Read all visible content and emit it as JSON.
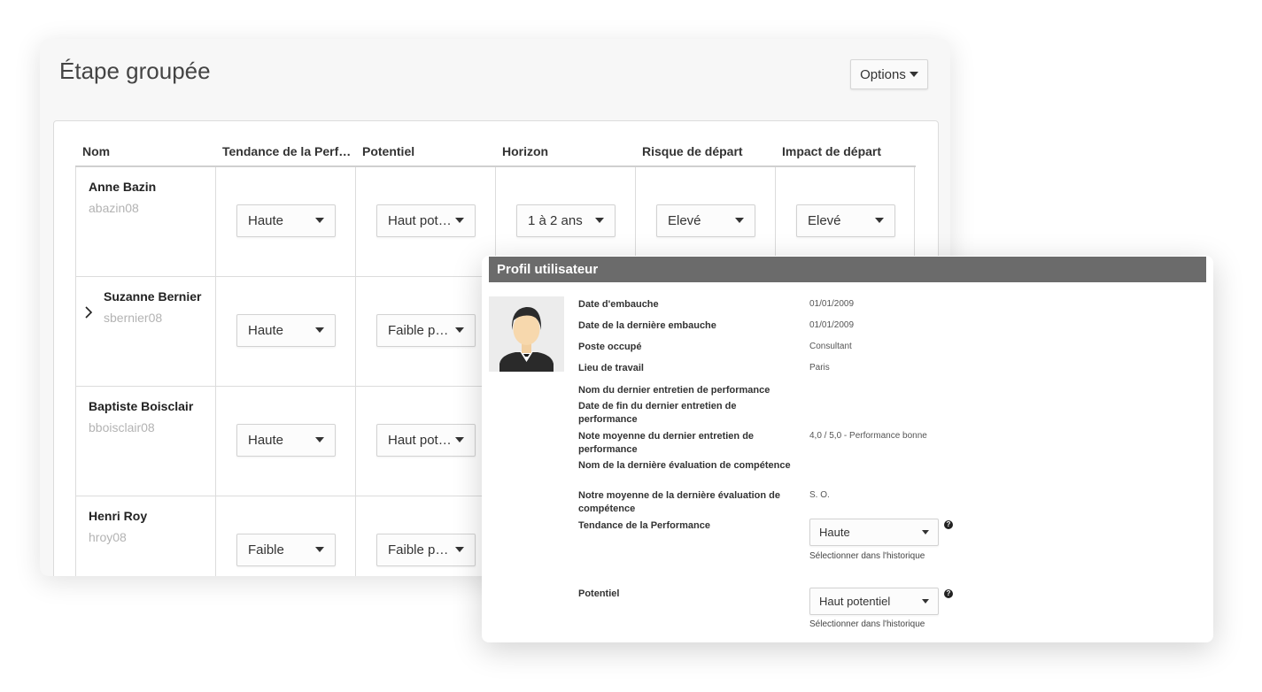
{
  "main": {
    "title": "Étape groupée",
    "options_label": "Options",
    "columns": [
      "Nom",
      "Tendance de la Performance",
      "Potentiel",
      "Horizon",
      "Risque de départ",
      "Impact de départ"
    ],
    "rows": [
      {
        "name": "Anne Bazin",
        "username": "abazin08",
        "performance": "Haute",
        "potentiel": "Haut potentiel",
        "horizon": "1 à 2 ans",
        "risque": "Elevé",
        "impact": "Elevé"
      },
      {
        "name": "Suzanne Bernier",
        "username": "sbernier08",
        "performance": "Haute",
        "potentiel": "Faible potentiel"
      },
      {
        "name": "Baptiste Boisclair",
        "username": "bboisclair08",
        "performance": "Haute",
        "potentiel": "Haut potentiel"
      },
      {
        "name": "Henri Roy",
        "username": "hroy08",
        "performance": "Faible",
        "potentiel": "Faible potentiel"
      }
    ]
  },
  "profile": {
    "title": "Profil utilisateur",
    "fields": [
      {
        "label": "Date d'embauche",
        "value": "01/01/2009"
      },
      {
        "label": "Date de la dernière embauche",
        "value": "01/01/2009"
      },
      {
        "label": "Poste occupé",
        "value": "Consultant"
      },
      {
        "label": "Lieu de travail",
        "value": "Paris"
      },
      {
        "label": "Nom du dernier entretien de performance",
        "value": ""
      },
      {
        "label": "Date de fin du dernier entretien de performance",
        "value": ""
      },
      {
        "label": "Note moyenne du dernier entretien de performance",
        "value": "4,0 / 5,0 - Performance bonne"
      },
      {
        "label": "Nom de la dernière évaluation de compétence",
        "value": ""
      },
      {
        "label": "Notre moyenne de la dernière évaluation de compétence",
        "value": "S. O."
      }
    ],
    "performance_label": "Tendance de la Performance",
    "performance_value": "Haute",
    "potentiel_label": "Potentiel",
    "potentiel_value": "Haut potentiel",
    "history_link": "Sélectionner dans l'historique",
    "help_glyph": "?"
  }
}
